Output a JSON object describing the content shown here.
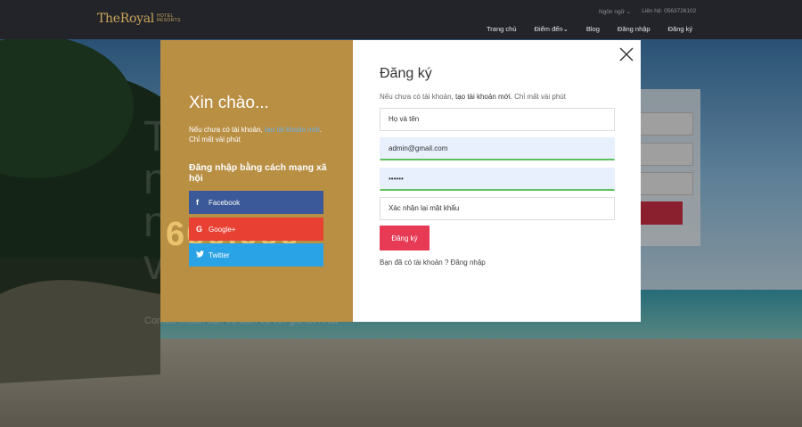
{
  "header": {
    "logo_main": "TheRoyal",
    "logo_sub_top": "HOTEL",
    "logo_sub_bottom": "RESORTS",
    "language": "Ngôn ngữ ⌄",
    "contact": "Liên hệ: 0563726102",
    "nav": [
      "Trang chủ",
      "Điểm đến⌄",
      "Blog",
      "Đăng nhập",
      "Đăng ký"
    ]
  },
  "background": {
    "hero_lines": [
      "T",
      "n",
      "n",
      "v"
    ],
    "hero_subtitle": "Combo khách sạn và dịch vụ với giá tốt nhất"
  },
  "modal": {
    "left": {
      "title": "Xin chào...",
      "intro_pre": "Nếu chưa có tài khoản, ",
      "intro_link": "tạo tài khoản mới",
      "intro_post": ". Chỉ mất vài phút",
      "social_heading": "Đăng nhập bằng cách mạng xã hội",
      "decorative_text": "600.000",
      "social_buttons": [
        {
          "icon": "f",
          "label": "Facebook"
        },
        {
          "icon": "G",
          "label": "Google+"
        },
        {
          "icon": "t",
          "label": "Twitter"
        }
      ]
    },
    "right": {
      "title": "Đăng ký",
      "subtitle_pre": "Nếu chưa có tài khoản, ",
      "subtitle_em": "tạo tài khoản mới.",
      "subtitle_post": " Chỉ mất vài phút",
      "fields": {
        "name_placeholder": "Họ và tên",
        "email_value": "admin@gmail.com",
        "password_value": "••••••",
        "confirm_placeholder": "Xác nhận lại mật khẩu"
      },
      "submit_label": "Đăng ký",
      "login_prompt": "Bạn đã có tài khoản ? Đăng nhập"
    }
  },
  "colors": {
    "gold": "#b98f44",
    "facebook": "#3b5998",
    "google": "#e84033",
    "twitter": "#2aa3e6",
    "submit": "#e63a55",
    "link": "#6ab0e6"
  }
}
